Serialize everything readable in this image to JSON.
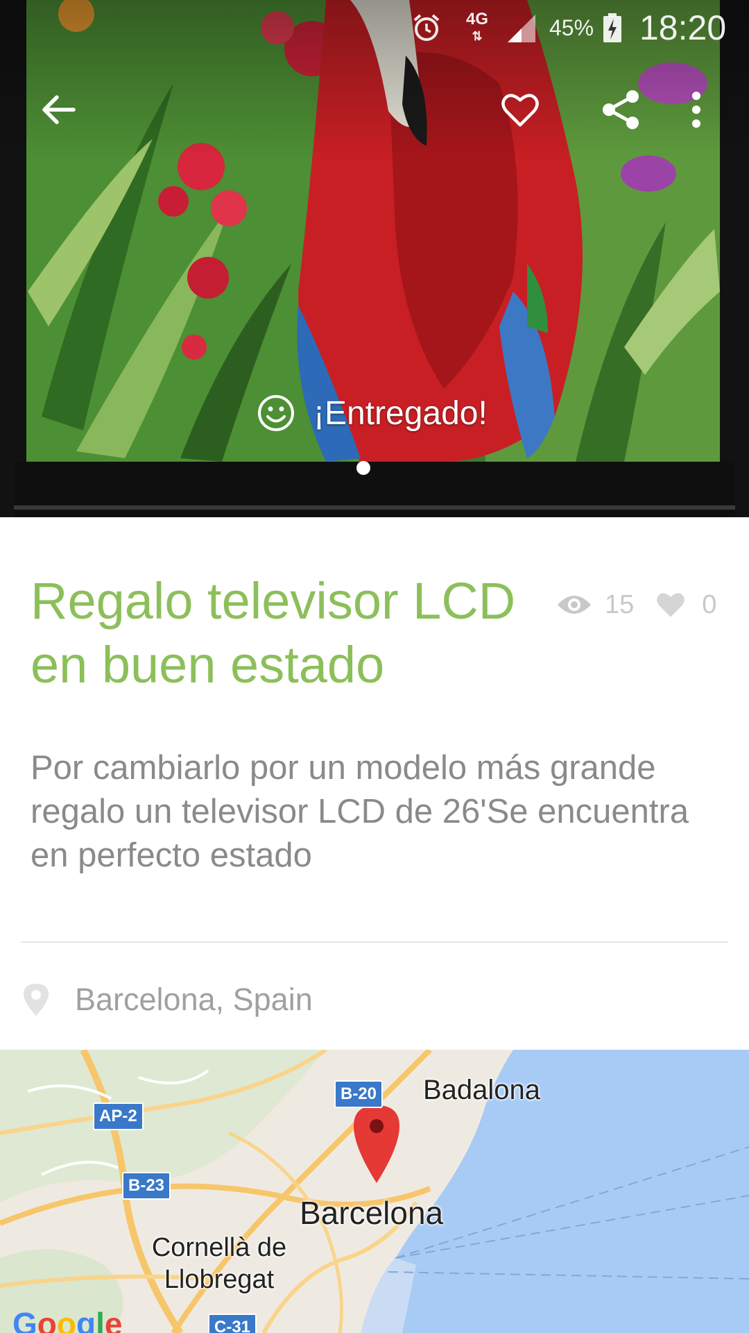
{
  "status_bar": {
    "network": "4G",
    "battery_percent": "45%",
    "time": "18:20"
  },
  "toolbar": {
    "back_icon": "arrow-left-icon",
    "favorite_icon": "heart-outline-icon",
    "share_icon": "share-icon",
    "more_icon": "more-vert-icon"
  },
  "hero": {
    "status_label": "¡Entregado!",
    "status_icon": "smiley-icon",
    "page_indicator": {
      "current": 1,
      "total": 1
    }
  },
  "listing": {
    "title": "Regalo televisor LCD en buen estado",
    "views": "15",
    "likes": "0",
    "description": "Por cambiarlo por un modelo más grande regalo un televisor LCD de 26'Se encuentra en perfecto estado",
    "location": "Barcelona, Spain"
  },
  "map": {
    "places": {
      "badalona": "Badalona",
      "barcelona": "Barcelona",
      "cornella": "Cornellà de Llobregat"
    },
    "roads": {
      "ap2": "AP-2",
      "b20": "B-20",
      "b23": "B-23",
      "c31": "C-31"
    },
    "attribution": "Google"
  },
  "colors": {
    "accent": "#8cbf5a",
    "muted_text": "#8a8a8a",
    "stats": "#c8c8c8",
    "sea": "#a8cbf5",
    "land": "#efeae1",
    "marker": "#e53935"
  }
}
